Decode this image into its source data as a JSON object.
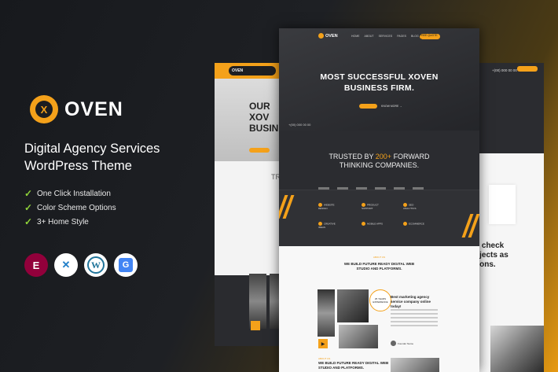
{
  "brand": {
    "name": "OVEN",
    "mark": "X",
    "tagline_line1": "Digital Agency Services",
    "tagline_line2": "WordPress Theme"
  },
  "features": [
    "One Click Installation",
    "Color Scheme Options",
    "3+ Home Style"
  ],
  "plugins": [
    {
      "name": "elementor-icon",
      "glyph": "E"
    },
    {
      "name": "wpml-icon",
      "glyph": "✕"
    },
    {
      "name": "wordpress-icon",
      "glyph": "W"
    },
    {
      "name": "translate-icon",
      "glyph": "G"
    }
  ],
  "colors": {
    "accent": "#f4a11a",
    "dark": "#1e2024",
    "check": "#8fd33a"
  },
  "main_preview": {
    "logo": "OVEN",
    "menu": [
      "HOME",
      "ABOUT",
      "SERVICES",
      "PAGES",
      "BLOG",
      "CONTACT"
    ],
    "cta": "FREE QUOTE →",
    "hero_title_line1": "MOST SUCCESSFUL XOVEN",
    "hero_title_line2": "BUSINESS FIRM.",
    "hero_secondary": "KNOW MORE →",
    "phone": "+(00) 000 00 00",
    "trusted_pre": "TRUSTED BY ",
    "trusted_highlight": "200+",
    "trusted_post": " FORWARD",
    "trusted_line2": "THINKING COMPANIES.",
    "feature_items": [
      "WEBSITE DESIGN",
      "PRODUCT SUPPORT",
      "SEO ANALYTICS",
      "CREATIVE IDEAS",
      "MOBILE APPS",
      "ECOMMERCE"
    ],
    "section_kicker": "ABOUT US",
    "section_title_line1": "WE BUILD FUTURE READY DIGITAL WEB",
    "section_title_line2": "STUDIO AND PLATFORMS.",
    "badge": "25 YEARS EXPERIENCE",
    "blurb": "Best marketing agency service company online today!",
    "author": "Founder Name",
    "bottom_kicker": "ABOUT US",
    "bottom_title_line1": "WE BUILD FUTURE READY DIGITAL WEB",
    "bottom_title_line2": "STUDIO AND PLATFORMS."
  },
  "left_preview": {
    "logo": "OVEN",
    "hero_line1": "OUR XOV",
    "hero_line2": "BUSINES",
    "trusted": "TRU",
    "bottom": "Hy"
  },
  "right_preview": {
    "phone": "+(00) 000 00 00",
    "big_line1": "n check",
    "big_line2": "ojects as",
    "big_line3": "tions."
  }
}
